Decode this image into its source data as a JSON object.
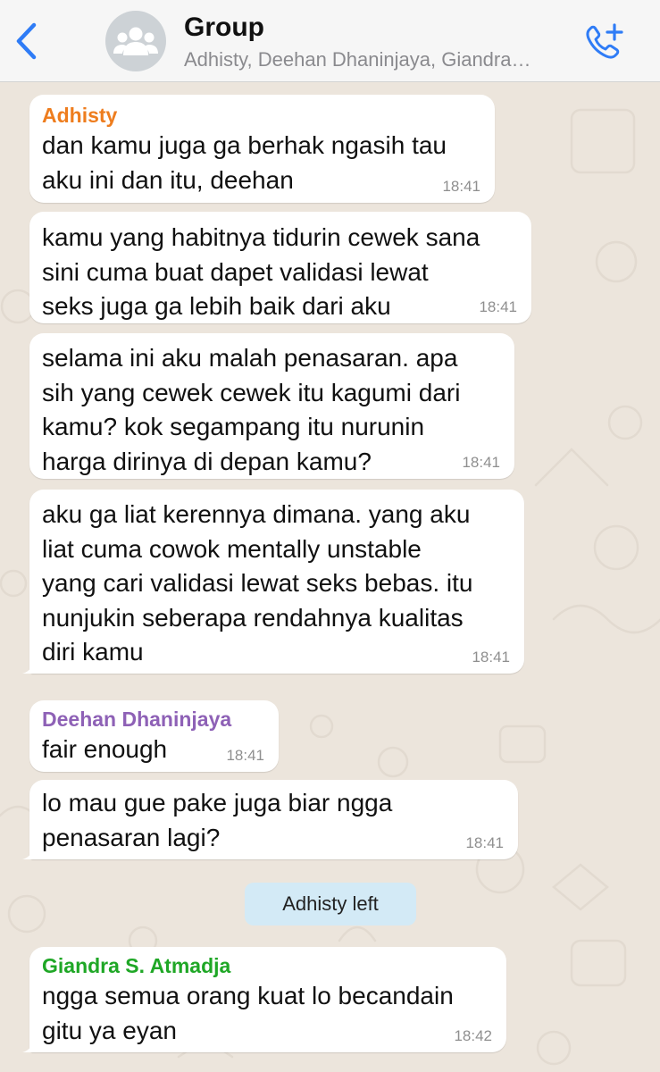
{
  "header": {
    "title": "Group",
    "subtitle": "Adhisty, Deehan Dhaninjaya, Giandra…"
  },
  "colors": {
    "accent": "#2f7cf6",
    "chat_background": "#ece5dc",
    "sender_adhisty": "#ee7d1e",
    "sender_deehan": "#8e61b6",
    "sender_giandra": "#1fa726",
    "system_message_bg": "#d3eaf6"
  },
  "icons": {
    "back": "chevron-left-icon",
    "avatar": "group-icon",
    "call": "add-call-icon"
  },
  "messages": [
    {
      "sender": "Adhisty",
      "text": "dan kamu juga ga berhak ngasih tau\naku ini dan itu, deehan",
      "time": "18:41"
    },
    {
      "text": "kamu yang habitnya tidurin cewek sana\nsini cuma buat dapet validasi lewat\nseks juga ga lebih baik dari aku",
      "time": "18:41"
    },
    {
      "text": "selama ini aku malah penasaran. apa\nsih yang cewek cewek itu kagumi dari\nkamu? kok segampang itu nurunin\nharga dirinya di depan kamu?",
      "time": "18:41"
    },
    {
      "text": "aku ga liat kerennya dimana. yang aku\nliat cuma cowok mentally unstable\nyang cari validasi lewat seks bebas. itu\nnunjukin seberapa rendahnya kualitas\ndiri kamu",
      "time": "18:41"
    },
    {
      "sender": "Deehan Dhaninjaya",
      "text": "fair enough",
      "time": "18:41"
    },
    {
      "text": "lo mau gue pake juga biar ngga\npenasaran lagi?",
      "time": "18:41"
    },
    {
      "sender": "Giandra S. Atmadja",
      "text": "ngga semua orang kuat lo becandain\ngitu ya eyan",
      "time": "18:42"
    }
  ],
  "system_message": "Adhisty left"
}
